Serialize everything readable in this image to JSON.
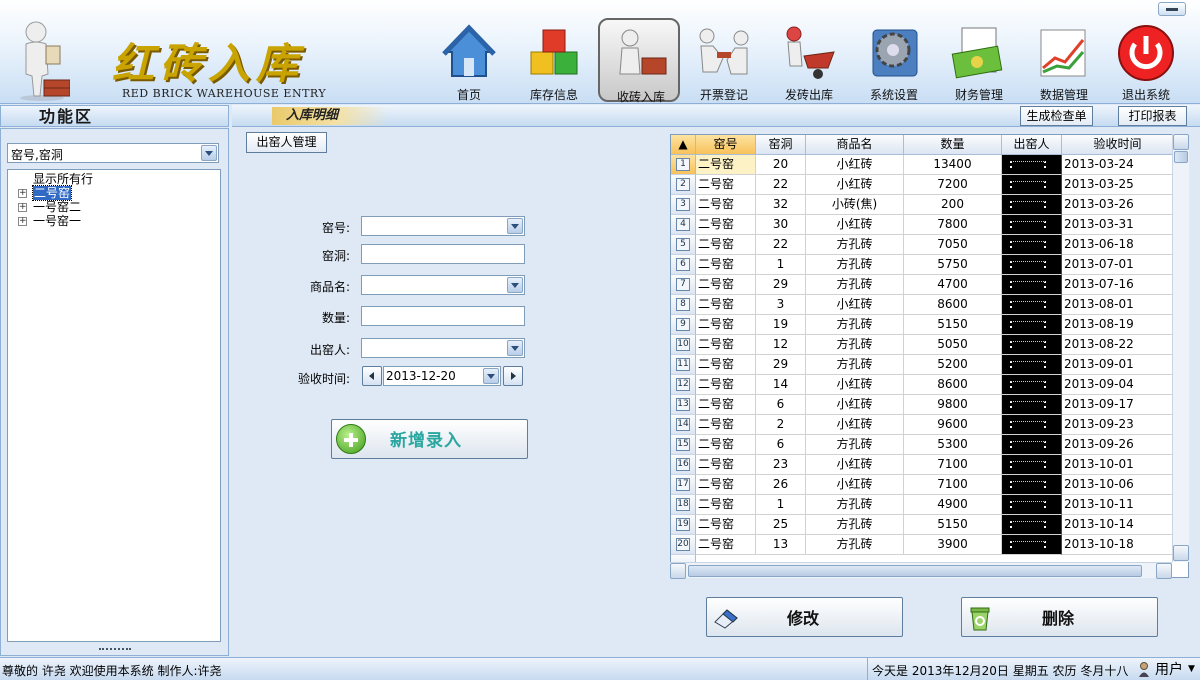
{
  "app": {
    "brand_title": "红砖入库",
    "brand_subtitle": "RED BRICK WAREHOUSE ENTRY"
  },
  "nav": [
    {
      "label": "首页",
      "icon": "house-icon"
    },
    {
      "label": "库存信息",
      "icon": "cubes-icon"
    },
    {
      "label": "收砖入库",
      "icon": "worker-bricks-icon",
      "active": true
    },
    {
      "label": "开票登记",
      "icon": "handshake-icon"
    },
    {
      "label": "发砖出库",
      "icon": "wheelbarrow-icon"
    },
    {
      "label": "系统设置",
      "icon": "gear-icon"
    },
    {
      "label": "财务管理",
      "icon": "money-icon"
    },
    {
      "label": "数据管理",
      "icon": "chart-icon"
    },
    {
      "label": "退出系统",
      "icon": "power-icon"
    }
  ],
  "left": {
    "title": "功能区",
    "filter_value": "窑号,窑洞",
    "tree": [
      {
        "label": "显示所有行",
        "expander": false
      },
      {
        "label": "二号窑",
        "expander": true,
        "selected": true
      },
      {
        "label": "一号窑二",
        "expander": true
      },
      {
        "label": "一号窑一",
        "expander": true
      }
    ]
  },
  "main": {
    "title": "入库明细",
    "generate_check_label": "生成检查单",
    "print_report_label": "打印报表",
    "kiln_manager_label": "出窑人管理"
  },
  "form": {
    "kiln_no_label": "窑号:",
    "kiln_hole_label": "窑洞:",
    "product_label": "商品名:",
    "quantity_label": "数量:",
    "outputter_label": "出窑人:",
    "date_label": "验收时间:",
    "date_value": "2013-12-20",
    "add_label": "新增录入"
  },
  "table": {
    "columns": [
      "窑号",
      "窑洞",
      "商品名",
      "数量",
      "出窑人",
      "验收时间"
    ],
    "rows": [
      {
        "n": "1",
        "kiln": "二号窑",
        "hole": "20",
        "product": "小红砖",
        "qty": "13400",
        "date": "2013-03-24"
      },
      {
        "n": "2",
        "kiln": "二号窑",
        "hole": "22",
        "product": "小红砖",
        "qty": "7200",
        "date": "2013-03-25"
      },
      {
        "n": "3",
        "kiln": "二号窑",
        "hole": "32",
        "product": "小砖(焦)",
        "qty": "200",
        "date": "2013-03-26"
      },
      {
        "n": "4",
        "kiln": "二号窑",
        "hole": "30",
        "product": "小红砖",
        "qty": "7800",
        "date": "2013-03-31"
      },
      {
        "n": "5",
        "kiln": "二号窑",
        "hole": "22",
        "product": "方孔砖",
        "qty": "7050",
        "date": "2013-06-18"
      },
      {
        "n": "6",
        "kiln": "二号窑",
        "hole": "1",
        "product": "方孔砖",
        "qty": "5750",
        "date": "2013-07-01"
      },
      {
        "n": "7",
        "kiln": "二号窑",
        "hole": "29",
        "product": "方孔砖",
        "qty": "4700",
        "date": "2013-07-16"
      },
      {
        "n": "8",
        "kiln": "二号窑",
        "hole": "3",
        "product": "小红砖",
        "qty": "8600",
        "date": "2013-08-01"
      },
      {
        "n": "9",
        "kiln": "二号窑",
        "hole": "19",
        "product": "方孔砖",
        "qty": "5150",
        "date": "2013-08-19"
      },
      {
        "n": "10",
        "kiln": "二号窑",
        "hole": "12",
        "product": "方孔砖",
        "qty": "5050",
        "date": "2013-08-22"
      },
      {
        "n": "11",
        "kiln": "二号窑",
        "hole": "29",
        "product": "方孔砖",
        "qty": "5200",
        "date": "2013-09-01"
      },
      {
        "n": "12",
        "kiln": "二号窑",
        "hole": "14",
        "product": "小红砖",
        "qty": "8600",
        "date": "2013-09-04"
      },
      {
        "n": "13",
        "kiln": "二号窑",
        "hole": "6",
        "product": "小红砖",
        "qty": "9800",
        "date": "2013-09-17"
      },
      {
        "n": "14",
        "kiln": "二号窑",
        "hole": "2",
        "product": "小红砖",
        "qty": "9600",
        "date": "2013-09-23"
      },
      {
        "n": "15",
        "kiln": "二号窑",
        "hole": "6",
        "product": "方孔砖",
        "qty": "5300",
        "date": "2013-09-26"
      },
      {
        "n": "16",
        "kiln": "二号窑",
        "hole": "23",
        "product": "小红砖",
        "qty": "7100",
        "date": "2013-10-01"
      },
      {
        "n": "17",
        "kiln": "二号窑",
        "hole": "26",
        "product": "小红砖",
        "qty": "7100",
        "date": "2013-10-06"
      },
      {
        "n": "18",
        "kiln": "二号窑",
        "hole": "1",
        "product": "方孔砖",
        "qty": "4900",
        "date": "2013-10-11"
      },
      {
        "n": "19",
        "kiln": "二号窑",
        "hole": "25",
        "product": "方孔砖",
        "qty": "5150",
        "date": "2013-10-14"
      },
      {
        "n": "20",
        "kiln": "二号窑",
        "hole": "13",
        "product": "方孔砖",
        "qty": "3900",
        "date": "2013-10-18"
      }
    ]
  },
  "actions": {
    "edit_label": "修改",
    "delete_label": "删除"
  },
  "status": {
    "left_text": "尊敬的 许尧 欢迎使用本系统   制作人:许尧",
    "date_text": "今天是 2013年12月20日 星期五  农历 冬月十八",
    "user_text": "用户"
  },
  "colors": {
    "accent": "#316ac5",
    "header_sorted": "#f7c25a",
    "selected_cell": "#fdf2c5",
    "brand_gold": "#c9a400",
    "add_text": "#2aa7a0"
  }
}
